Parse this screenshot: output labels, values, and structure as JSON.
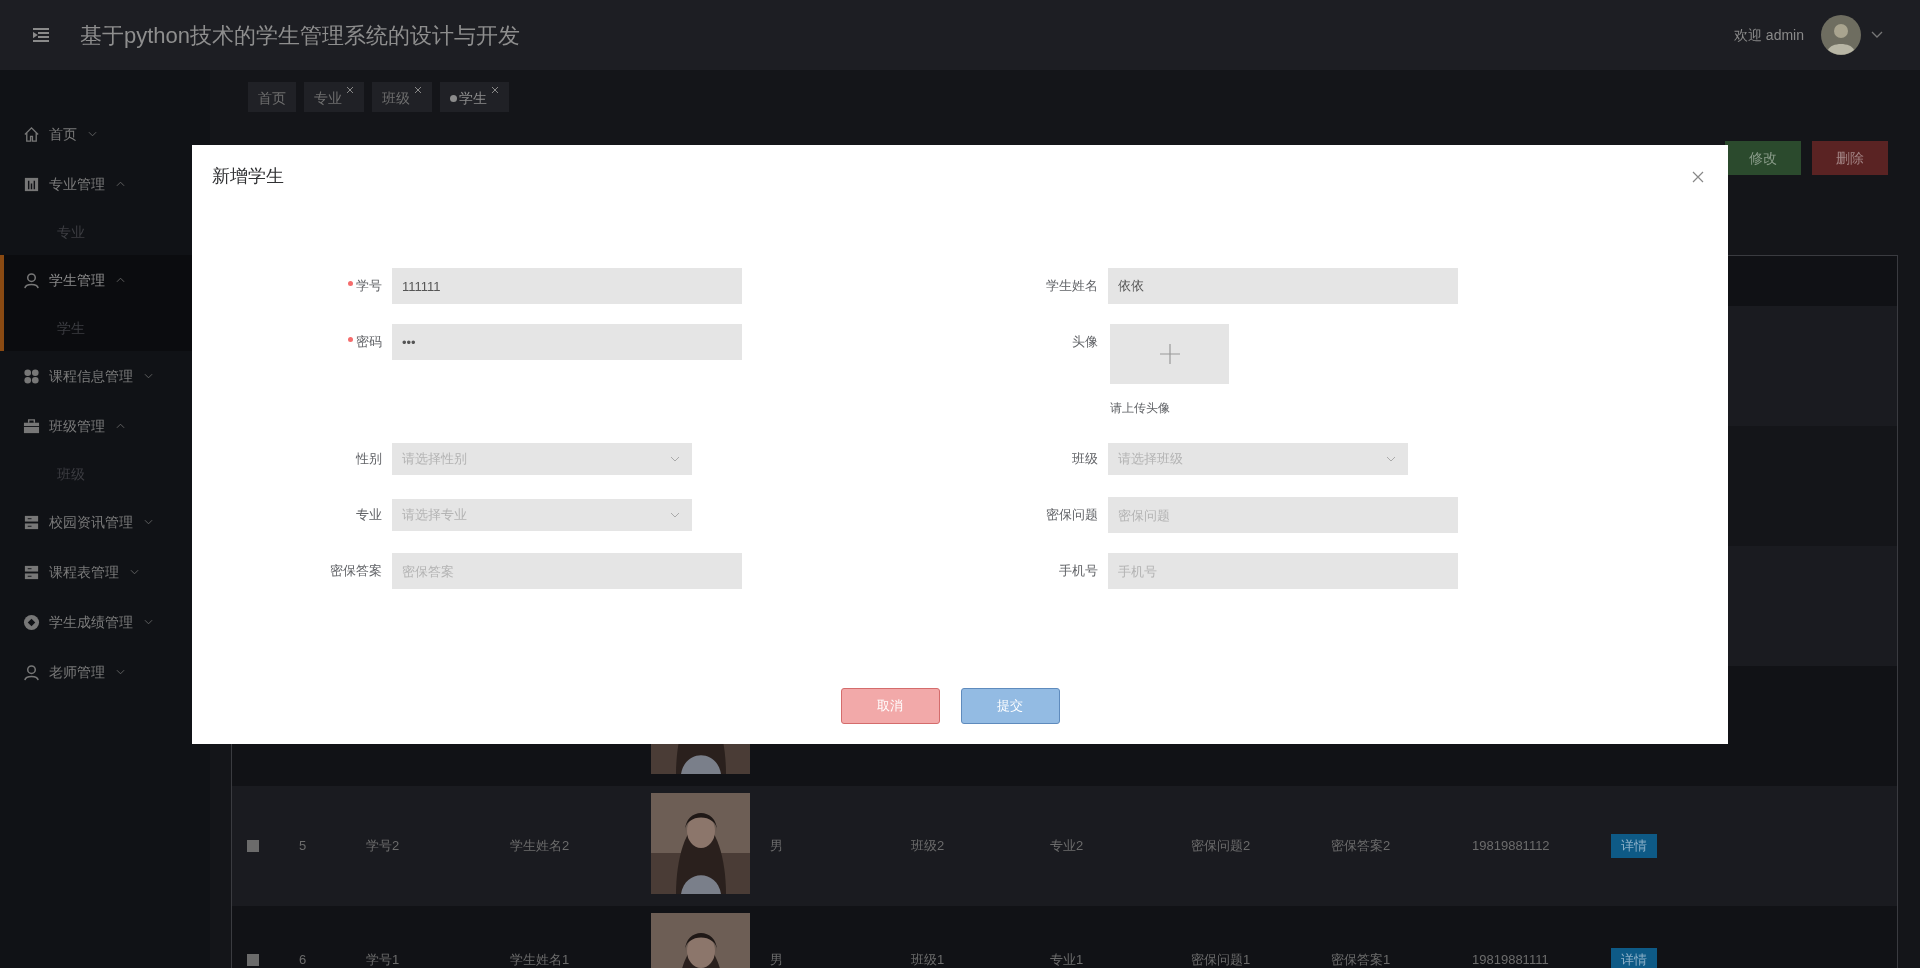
{
  "header": {
    "title": "基于python技术的学生管理系统的设计与开发",
    "welcome": "欢迎 admin"
  },
  "sidebar": {
    "items": [
      {
        "label": "首页",
        "expanded": false,
        "selected": false
      },
      {
        "label": "专业管理",
        "expanded": true,
        "selected": false,
        "children": [
          {
            "label": "专业"
          }
        ]
      },
      {
        "label": "学生管理",
        "expanded": true,
        "selected": true,
        "children": [
          {
            "label": "学生"
          }
        ]
      },
      {
        "label": "课程信息管理",
        "expanded": false,
        "selected": false
      },
      {
        "label": "班级管理",
        "expanded": true,
        "selected": false,
        "children": [
          {
            "label": "班级"
          }
        ]
      },
      {
        "label": "校园资讯管理",
        "expanded": false,
        "selected": false
      },
      {
        "label": "课程表管理",
        "expanded": false,
        "selected": false
      },
      {
        "label": "学生成绩管理",
        "expanded": false,
        "selected": false
      },
      {
        "label": "老师管理",
        "expanded": false,
        "selected": false
      }
    ]
  },
  "tabs": [
    {
      "label": "首页",
      "selected": false,
      "closable": false
    },
    {
      "label": "专业",
      "selected": false,
      "closable": true
    },
    {
      "label": "班级",
      "selected": false,
      "closable": true
    },
    {
      "label": "学生",
      "selected": true,
      "closable": true
    }
  ],
  "toolbar": {
    "buttons": [
      {
        "label": "修改",
        "kind": "edit"
      },
      {
        "label": "删除",
        "kind": "delete"
      }
    ]
  },
  "table": {
    "rows": [
      {
        "kind": "cut"
      },
      {
        "kind": "full",
        "checked": false,
        "cells": [
          "5",
          "学号2",
          "学生姓名2",
          "男",
          "班级2",
          "专业2",
          "密保问题2",
          "密保答案2",
          "19819881112"
        ],
        "action": "详情"
      },
      {
        "kind": "full",
        "checked": false,
        "cells": [
          "6",
          "学号1",
          "学生姓名1",
          "男",
          "班级1",
          "专业1",
          "密保问题1",
          "密保答案1",
          "19819881111"
        ],
        "action": "详情"
      }
    ]
  },
  "dialog": {
    "title": "新增学生",
    "fields": [
      {
        "label": "学号",
        "kind": "input",
        "required": true,
        "value": "111111"
      },
      {
        "label": "学生姓名",
        "kind": "input",
        "required": false,
        "value": "依依"
      },
      {
        "label": "密码",
        "kind": "input",
        "required": true,
        "value": "•••"
      },
      {
        "label": "头像",
        "kind": "upload",
        "required": false,
        "hint": "请上传头像"
      },
      {
        "label": "性别",
        "kind": "select",
        "required": false,
        "placeholder": "请选择性别"
      },
      {
        "label": "班级",
        "kind": "select",
        "required": false,
        "placeholder": "请选择班级"
      },
      {
        "label": "专业",
        "kind": "select",
        "required": false,
        "placeholder": "请选择专业"
      },
      {
        "label": "密保问题",
        "kind": "input",
        "required": false,
        "placeholder": "密保问题"
      },
      {
        "label": "密保答案",
        "kind": "input",
        "required": false,
        "placeholder": "密保答案"
      },
      {
        "label": "手机号",
        "kind": "input",
        "required": false,
        "placeholder": "手机号"
      }
    ],
    "buttons": [
      {
        "label": "取消",
        "kind": "cancel"
      },
      {
        "label": "提交",
        "kind": "submit"
      }
    ]
  }
}
